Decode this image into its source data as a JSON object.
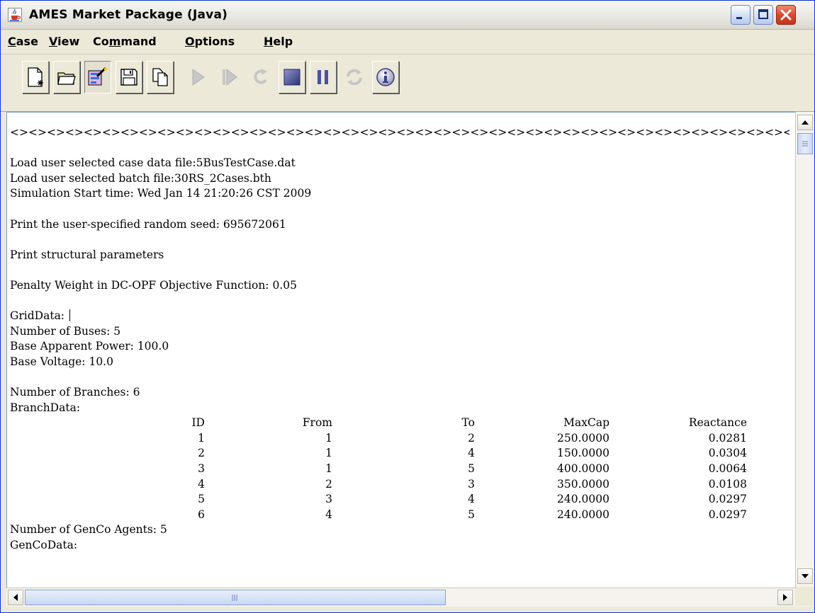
{
  "window": {
    "title": "AMES Market Package (Java)",
    "icon": "java-cup-icon"
  },
  "menu": {
    "items": [
      {
        "label": "Case",
        "mnemonic": "C",
        "rest": "ase"
      },
      {
        "label": "View",
        "mnemonic": "V",
        "rest": "iew"
      },
      {
        "label": "Command",
        "pre": "Co",
        "mnemonic": "m",
        "rest": "mand"
      },
      {
        "label": "Options",
        "mnemonic": "O",
        "rest": "ptions"
      },
      {
        "label": "Help",
        "mnemonic": "H",
        "rest": "elp"
      }
    ]
  },
  "toolbar": {
    "buttons": [
      {
        "name": "new-case",
        "icon": "new-document-icon",
        "enabled": true
      },
      {
        "name": "open-case",
        "icon": "open-folder-icon",
        "enabled": true
      },
      {
        "name": "case-wizard",
        "icon": "wizard-icon",
        "enabled": true
      },
      {
        "name": "save-case",
        "icon": "floppy-disk-icon",
        "enabled": true
      },
      {
        "name": "copy",
        "icon": "copy-icon",
        "enabled": true
      },
      {
        "name": "run",
        "icon": "play-icon",
        "enabled": false
      },
      {
        "name": "step",
        "icon": "step-icon",
        "enabled": false
      },
      {
        "name": "restart",
        "icon": "restart-icon",
        "enabled": false
      },
      {
        "name": "stop",
        "icon": "stop-icon",
        "enabled": true
      },
      {
        "name": "pause",
        "icon": "pause-icon",
        "enabled": true
      },
      {
        "name": "refresh",
        "icon": "refresh-icon",
        "enabled": false
      },
      {
        "name": "about",
        "icon": "info-icon",
        "enabled": true
      }
    ]
  },
  "console": {
    "separator": "<><><><><><><><><><><><><><><><><><><><><><><><><><><><><><><><><><><><><><><><><><><><><><><>",
    "line_case_file": "Load user selected case data file:5BusTestCase.dat",
    "line_batch_file": "Load user selected batch file:30RS_2Cases.bth",
    "line_start_time": "Simulation Start time: Wed Jan 14 21:20:26 CST 2009",
    "line_seed": "Print the user-specified random seed: 695672061",
    "line_struct": "Print structural parameters",
    "line_penalty": "Penalty Weight in DC-OPF Objective Function: 0.05",
    "line_griddata": "GridData: ",
    "line_buses": "Number of Buses: 5",
    "line_power": "Base Apparent Power: 100.0",
    "line_voltage": "Base Voltage: 10.0",
    "line_branches": "Number of Branches: 6",
    "line_branchdata": "BranchData:",
    "branch_table": {
      "headers": [
        "ID",
        "From",
        "To",
        "MaxCap",
        "Reactance"
      ],
      "rows": [
        [
          "1",
          "1",
          "2",
          "250.0000",
          "0.0281"
        ],
        [
          "2",
          "1",
          "4",
          "150.0000",
          "0.0304"
        ],
        [
          "3",
          "1",
          "5",
          "400.0000",
          "0.0064"
        ],
        [
          "4",
          "2",
          "3",
          "350.0000",
          "0.0108"
        ],
        [
          "5",
          "3",
          "4",
          "240.0000",
          "0.0297"
        ],
        [
          "6",
          "4",
          "5",
          "240.0000",
          "0.0297"
        ]
      ]
    },
    "line_genco": "Number of GenCo Agents: 5",
    "line_gencodata": "GenCoData:"
  },
  "colors": {
    "title_bar": "#ece9d8",
    "close_button": "#d8432b",
    "border": "#0831d9"
  }
}
